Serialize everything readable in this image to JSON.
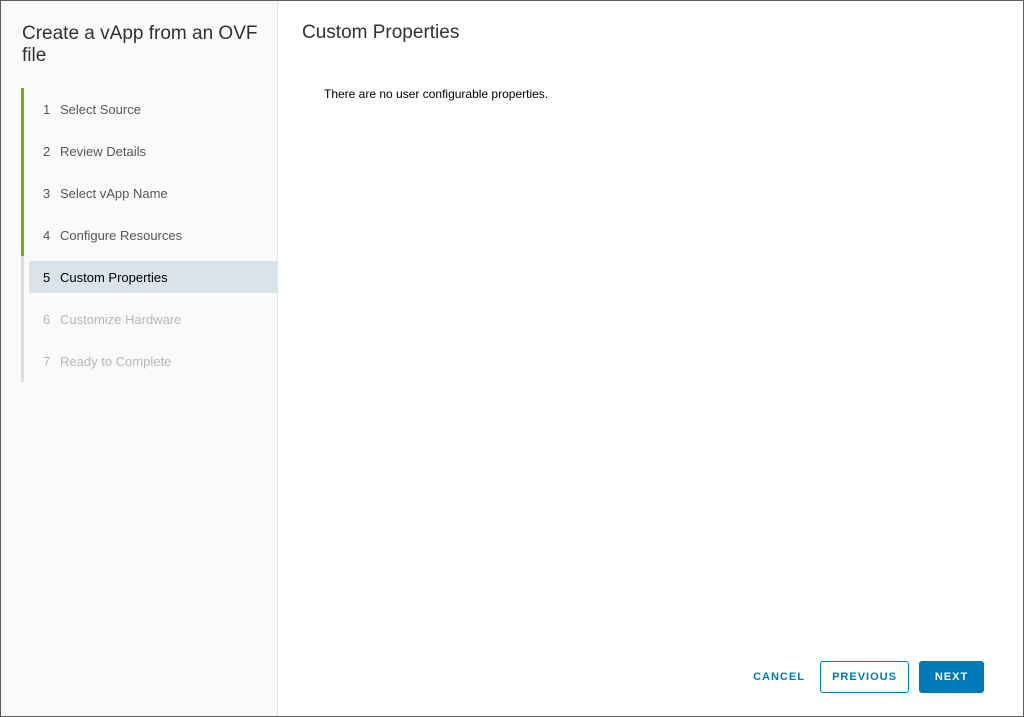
{
  "wizard": {
    "title": "Create a vApp from an OVF file"
  },
  "steps": [
    {
      "num": "1",
      "label": "Select Source",
      "state": "done"
    },
    {
      "num": "2",
      "label": "Review Details",
      "state": "done"
    },
    {
      "num": "3",
      "label": "Select vApp Name",
      "state": "done"
    },
    {
      "num": "4",
      "label": "Configure Resources",
      "state": "done"
    },
    {
      "num": "5",
      "label": "Custom Properties",
      "state": "current"
    },
    {
      "num": "6",
      "label": "Customize Hardware",
      "state": "todo"
    },
    {
      "num": "7",
      "label": "Ready to Complete",
      "state": "todo"
    }
  ],
  "content": {
    "title": "Custom Properties",
    "message": "There are no user configurable properties."
  },
  "footer": {
    "cancel_label": "CANCEL",
    "previous_label": "PREVIOUS",
    "next_label": "NEXT"
  },
  "colors": {
    "accent": "#0079b8",
    "step_done": "#60b515",
    "step_current_bg": "#d9e4ea"
  }
}
